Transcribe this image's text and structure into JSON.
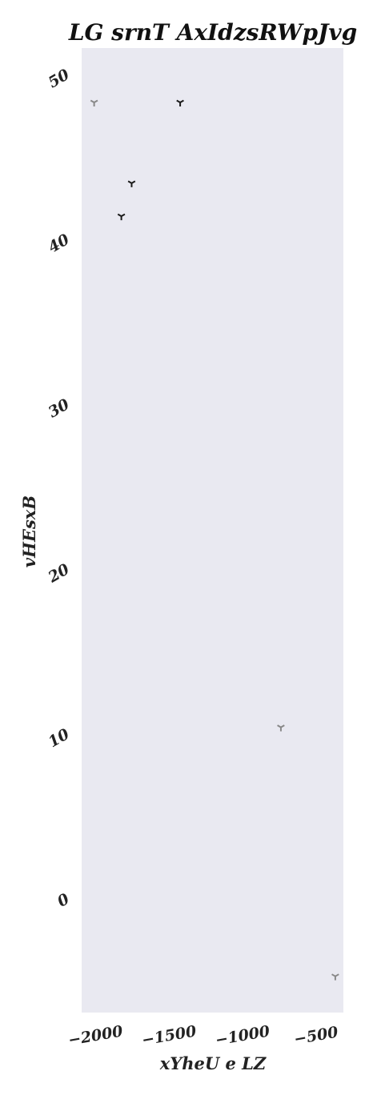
{
  "chart_data": {
    "type": "scatter",
    "title": "LG  srnT AxIdzsRWpJvg",
    "xlabel": "xYheU e LZ",
    "ylabel": "vHEsxB",
    "xlim": [
      -2100,
      -320
    ],
    "ylim": [
      -7.0,
      51.5
    ],
    "xticks": [
      -2000,
      -1500,
      -1000,
      -500
    ],
    "xtick_labels": [
      "−2000",
      "−1500",
      "−1000",
      "−500"
    ],
    "yticks": [
      0,
      10,
      20,
      30,
      40,
      50
    ],
    "ytick_labels": [
      "0",
      "10",
      "20",
      "30",
      "40",
      "50"
    ],
    "grid": false,
    "background": "#e9e9f1",
    "marker": "tri_down",
    "series": [
      {
        "color": "#1a1a1a",
        "points": [
          {
            "x": -1430,
            "y": 48.2
          },
          {
            "x": -1760,
            "y": 43.3
          },
          {
            "x": -1830,
            "y": 41.3
          }
        ]
      },
      {
        "color": "#888888",
        "points": [
          {
            "x": -2015,
            "y": 48.2
          },
          {
            "x": -745,
            "y": 10.3
          },
          {
            "x": -375,
            "y": -4.8
          }
        ]
      }
    ]
  }
}
